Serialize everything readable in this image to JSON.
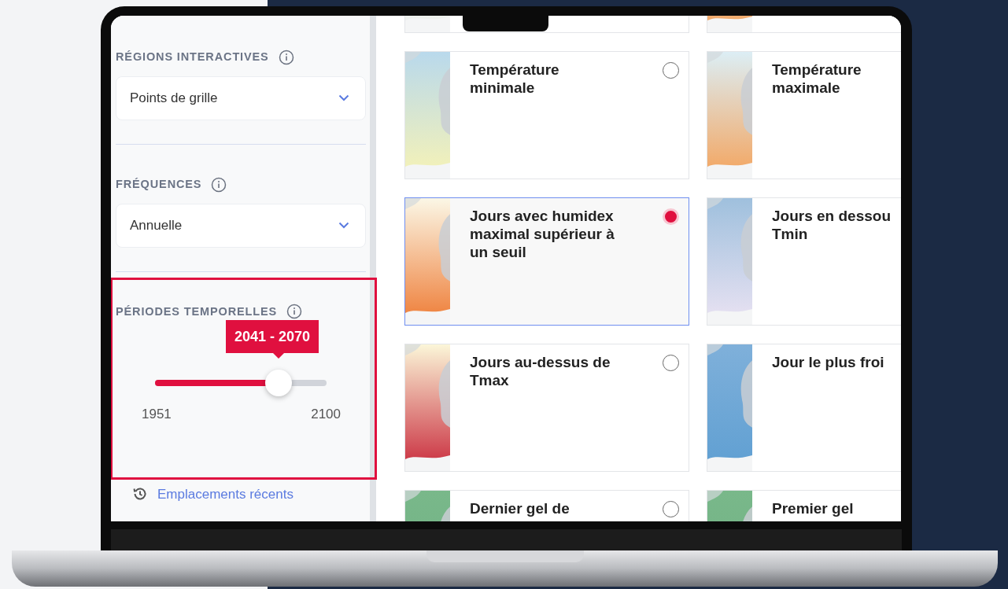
{
  "sidebar": {
    "sections": [
      {
        "heading": "RÉGIONS INTERACTIVES",
        "kind": "dropdown",
        "value": "Points de grille"
      },
      {
        "heading": "FRÉQUENCES",
        "kind": "dropdown",
        "value": "Annuelle"
      },
      {
        "heading": "PÉRIODES TEMPORELLES",
        "kind": "range",
        "tooltip": "2041 - 2070",
        "level": 0.72,
        "min_label": "1951",
        "max_label": "2100",
        "highlighted": true
      }
    ],
    "link": "Emplacements récents"
  },
  "cards": [
    {
      "kind": "pale"
    },
    {
      "kind": "warm"
    },
    {
      "title": "Température minimale",
      "kind": "cool",
      "selected": false
    },
    {
      "title": "Température maximale",
      "kind": "warm"
    },
    {
      "title": "Jours avec humidex maximal supérieur à un seuil",
      "kind": "hot",
      "selected": true
    },
    {
      "title": "Jours en dessou Tmin",
      "kind": "lavender"
    },
    {
      "title": "Jours au-dessus de Tmax",
      "kind": "red",
      "selected": false
    },
    {
      "title": "Jour le plus froi",
      "kind": "blue"
    },
    {
      "title": "Dernier gel de",
      "kind": "green",
      "selected": false
    },
    {
      "title": "Premier gel",
      "kind": "green"
    }
  ]
}
